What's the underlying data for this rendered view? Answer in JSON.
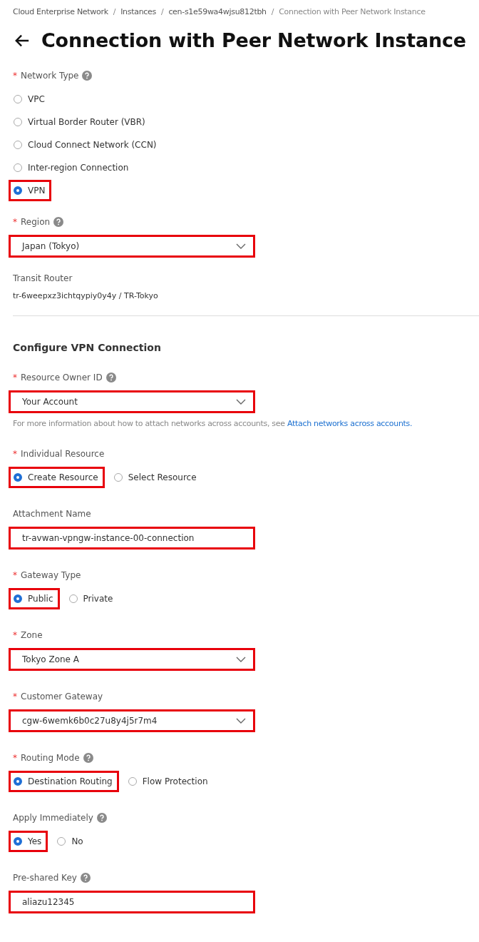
{
  "breadcrumb": [
    "Cloud Enterprise Network",
    "Instances",
    "cen-s1e59wa4wjsu812tbh",
    "Connection with Peer Network Instance"
  ],
  "breadcrumb_separator": "/",
  "required_mark": "*",
  "title": "Connection with Peer Network Instance",
  "fields": [
    {
      "kind": "radio_list",
      "label": "Network Type",
      "required": true,
      "help": true,
      "options": [
        {
          "label": "VPC",
          "selected": false,
          "highlighted": false
        },
        {
          "label": "Virtual Border Router (VBR)",
          "selected": false,
          "highlighted": false
        },
        {
          "label": "Cloud Connect Network (CCN)",
          "selected": false,
          "highlighted": false
        },
        {
          "label": "Inter-region Connection",
          "selected": false,
          "highlighted": false
        },
        {
          "label": "VPN",
          "selected": true,
          "highlighted": true
        }
      ]
    },
    {
      "kind": "select",
      "label": "Region",
      "required": true,
      "help": true,
      "value": "Japan (Tokyo)",
      "highlighted": true
    },
    {
      "kind": "static",
      "label": "Transit Router",
      "value": "tr-6weepxz3ichtqypiy0y4y / TR-Tokyo"
    }
  ],
  "section": {
    "title": "Configure VPN Connection",
    "fields": [
      {
        "kind": "select",
        "label": "Resource Owner ID",
        "required": true,
        "help": true,
        "value": "Your Account",
        "highlighted": true,
        "note": "For more information about how to attach networks across accounts, see ",
        "note_link": "Attach networks across accounts."
      },
      {
        "kind": "radio",
        "label": "Individual Resource",
        "required": true,
        "options": [
          {
            "label": "Create Resource",
            "selected": true,
            "highlighted": true
          },
          {
            "label": "Select Resource",
            "selected": false,
            "highlighted": false
          }
        ]
      },
      {
        "kind": "input",
        "label": "Attachment Name",
        "value": "tr-avwan-vpngw-instance-00-connection",
        "highlighted": true
      },
      {
        "kind": "radio",
        "label": "Gateway Type",
        "required": true,
        "options": [
          {
            "label": "Public",
            "selected": true,
            "highlighted": true
          },
          {
            "label": "Private",
            "selected": false,
            "highlighted": false
          }
        ]
      },
      {
        "kind": "select",
        "label": "Zone",
        "required": true,
        "value": "Tokyo Zone A",
        "highlighted": true
      },
      {
        "kind": "select",
        "label": "Customer Gateway",
        "required": true,
        "value": "cgw-6wemk6b0c27u8y4j5r7m4",
        "highlighted": true
      },
      {
        "kind": "radio",
        "label": "Routing Mode",
        "required": true,
        "help": true,
        "options": [
          {
            "label": "Destination Routing",
            "selected": true,
            "highlighted": true
          },
          {
            "label": "Flow Protection",
            "selected": false,
            "highlighted": false
          }
        ]
      },
      {
        "kind": "radio",
        "label": "Apply Immediately",
        "help": true,
        "options": [
          {
            "label": "Yes",
            "selected": true,
            "highlighted": true
          },
          {
            "label": "No",
            "selected": false,
            "highlighted": false
          }
        ]
      },
      {
        "kind": "input",
        "label": "Pre-shared Key",
        "help": true,
        "value": "aliazu12345",
        "highlighted": true
      }
    ]
  }
}
